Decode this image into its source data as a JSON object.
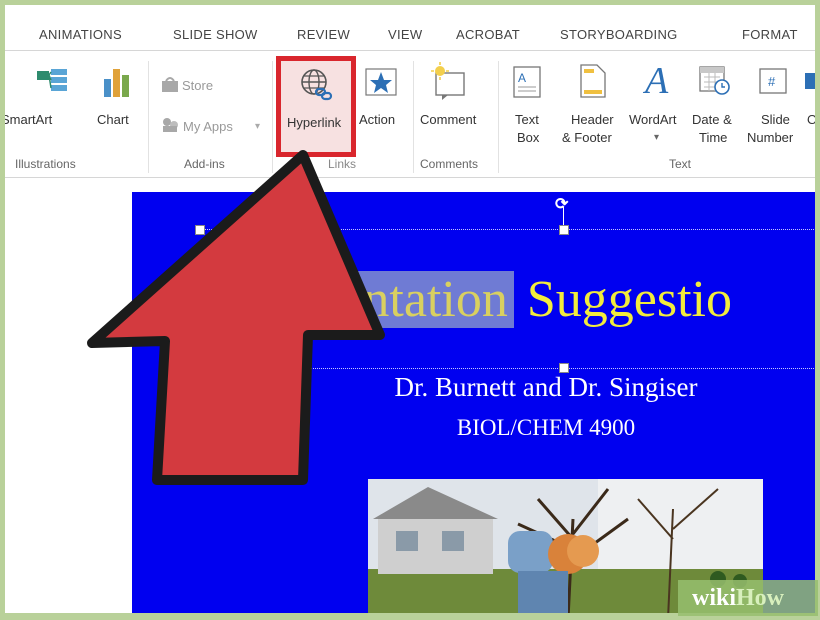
{
  "ribbon_tabs": [
    "ANIMATIONS",
    "SLIDE SHOW",
    "REVIEW",
    "VIEW",
    "ACROBAT",
    "STORYBOARDING",
    "FORMAT"
  ],
  "groups": {
    "illustrations": {
      "label": "Illustrations",
      "smartart": "SmartArt",
      "chart": "Chart"
    },
    "addins": {
      "label": "Add-ins",
      "store": "Store",
      "myapps": "My Apps"
    },
    "links": {
      "label": "Links",
      "hyperlink": "Hyperlink",
      "action": "Action"
    },
    "comments": {
      "label": "Comments",
      "comment": "Comment"
    },
    "text": {
      "label": "Text",
      "textbox_1": "Text",
      "textbox_2": "Box",
      "header_1": "Header",
      "header_2": "& Footer",
      "wordart": "WordArt",
      "datetime_1": "Date &",
      "datetime_2": "Time",
      "slidenum_1": "Slide",
      "slidenum_2": "Number",
      "object": "O"
    }
  },
  "slide": {
    "title_selected": "esentation",
    "title_rest": " Suggestio",
    "subtitle_1": "Dr. Burnett and Dr. Singiser",
    "subtitle_2": "BIOL/CHEM 4900"
  },
  "watermark": {
    "wiki": "wiki",
    "how": "How"
  },
  "colors": {
    "slide_bg": "#0000f0",
    "title": "#f2ec3c",
    "highlight_box": "#d9262d",
    "arrow": "#d33a3f"
  }
}
